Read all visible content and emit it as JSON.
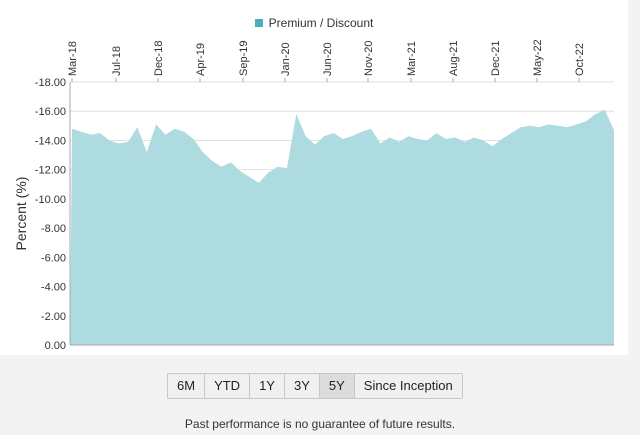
{
  "legend": {
    "label": "Premium / Discount",
    "color": "#4bb0bd"
  },
  "range_buttons": [
    {
      "label": "6M"
    },
    {
      "label": "YTD"
    },
    {
      "label": "1Y"
    },
    {
      "label": "3Y"
    },
    {
      "label": "5Y",
      "active": true
    },
    {
      "label": "Since Inception"
    }
  ],
  "disclaimer": "Past performance is no guarantee of future results.",
  "chart_data": {
    "type": "area",
    "ylabel": "Percent (%)",
    "ylim": [
      -18,
      0
    ],
    "yticks": [
      0,
      -2,
      -4,
      -6,
      -8,
      -10,
      -12,
      -14,
      -16,
      -18
    ],
    "ytick_labels": [
      "0.00",
      "-2.00",
      "-4.00",
      "-6.00",
      "-8.00",
      "-10.00",
      "-12.00",
      "-14.00",
      "-16.00",
      "-18.00"
    ],
    "xticks": [
      "Mar-18",
      "Jul-18",
      "Dec-18",
      "Apr-19",
      "Sep-19",
      "Jan-20",
      "Jun-20",
      "Nov-20",
      "Mar-21",
      "Aug-21",
      "Dec-21",
      "May-22",
      "Oct-22"
    ],
    "fill_color": "#aedbe0",
    "series": [
      {
        "name": "Premium / Discount",
        "x": [
          "Mar-18",
          "Apr-18",
          "May-18",
          "Jun-18",
          "Jul-18",
          "Aug-18",
          "Sep-18",
          "Oct-18",
          "Nov-18",
          "Dec-18",
          "Jan-19",
          "Feb-19",
          "Mar-19",
          "Apr-19",
          "May-19",
          "Jun-19",
          "Jul-19",
          "Aug-19",
          "Sep-19",
          "Oct-19",
          "Nov-19",
          "Dec-19",
          "Jan-20",
          "Feb-20",
          "Mar-20",
          "Apr-20",
          "May-20",
          "Jun-20",
          "Jul-20",
          "Aug-20",
          "Sep-20",
          "Oct-20",
          "Nov-20",
          "Dec-20",
          "Jan-21",
          "Feb-21",
          "Mar-21",
          "Apr-21",
          "May-21",
          "Jun-21",
          "Jul-21",
          "Aug-21",
          "Sep-21",
          "Oct-21",
          "Nov-21",
          "Dec-21",
          "Jan-22",
          "Feb-22",
          "Mar-22",
          "Apr-22",
          "May-22",
          "Jun-22",
          "Jul-22",
          "Aug-22",
          "Sep-22",
          "Oct-22",
          "Nov-22",
          "Dec-22",
          "Jan-23"
        ],
        "values": [
          -14.8,
          -14.6,
          -14.4,
          -14.5,
          -14.0,
          -13.8,
          -13.9,
          -14.9,
          -13.2,
          -15.1,
          -14.4,
          -14.8,
          -14.6,
          -14.1,
          -13.2,
          -12.6,
          -12.2,
          -12.5,
          -11.9,
          -11.5,
          -11.1,
          -11.8,
          -12.2,
          -12.1,
          -15.8,
          -14.3,
          -13.7,
          -14.3,
          -14.5,
          -14.1,
          -14.3,
          -14.6,
          -14.8,
          -13.8,
          -14.2,
          -13.9,
          -14.3,
          -14.1,
          -14.0,
          -14.5,
          -14.1,
          -14.2,
          -13.9,
          -14.2,
          -14.0,
          -13.6,
          -14.1,
          -14.5,
          -14.9,
          -15.0,
          -14.9,
          -15.1,
          -15.0,
          -14.9,
          -15.1,
          -15.3,
          -15.8,
          -16.1,
          -14.7
        ]
      }
    ]
  }
}
